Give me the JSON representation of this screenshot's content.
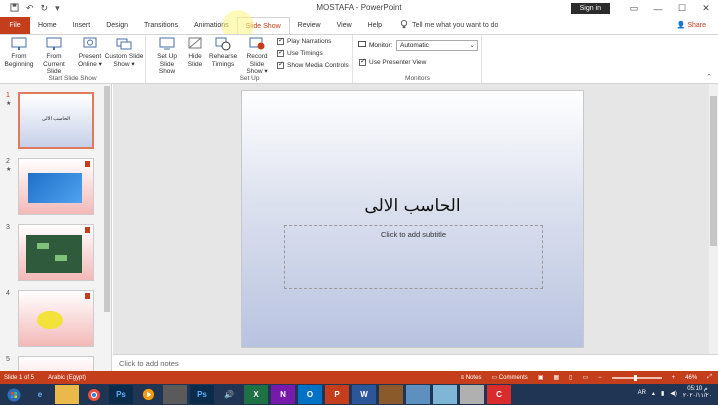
{
  "window": {
    "title": "MOSTAFA - PowerPoint",
    "sign_in": "Sign in",
    "controls": [
      "—",
      "☐",
      "✕"
    ]
  },
  "qat": {
    "save_icon": "save-icon",
    "undo_icon": "undo-icon",
    "redo_icon": "redo-icon"
  },
  "tabs": [
    {
      "label": "File"
    },
    {
      "label": "Home"
    },
    {
      "label": "Insert"
    },
    {
      "label": "Design"
    },
    {
      "label": "Transitions"
    },
    {
      "label": "Animations"
    },
    {
      "label": "Slide Show",
      "active": true
    },
    {
      "label": "Review"
    },
    {
      "label": "View"
    },
    {
      "label": "Help"
    }
  ],
  "tell_me": "Tell me what you want to do",
  "share": "Share",
  "ribbon": {
    "start_group": {
      "label": "Start Slide Show",
      "from_beginning": [
        "From",
        "Beginning"
      ],
      "from_current": [
        "From",
        "Current Slide"
      ],
      "present_online": [
        "Present",
        "Online ▾"
      ],
      "custom_show": [
        "Custom Slide",
        "Show ▾"
      ]
    },
    "setup_group": {
      "label": "Set Up",
      "setup": [
        "Set Up",
        "Slide Show"
      ],
      "hide": [
        "Hide",
        "Slide"
      ],
      "rehearse": [
        "Rehearse",
        "Timings"
      ],
      "record": [
        "Record Slide",
        "Show ▾"
      ],
      "play_narrations": "Play Narrations",
      "use_timings": "Use Timings",
      "show_media": "Show Media Controls"
    },
    "monitors_group": {
      "label": "Monitors",
      "monitor_label": "Monitor:",
      "monitor_value": "Automatic",
      "presenter_view": "Use Presenter View"
    }
  },
  "thumbnails": [
    {
      "num": "1",
      "caption": "الحاسب الالى",
      "star": "★"
    },
    {
      "num": "2",
      "star": "★"
    },
    {
      "num": "3"
    },
    {
      "num": "4"
    },
    {
      "num": "5"
    }
  ],
  "slide": {
    "title": "الحاسب الالى",
    "subtitle_placeholder": "Click to add subtitle"
  },
  "notes_placeholder": "Click to add notes",
  "status": {
    "slide_counter": "Slide 1 of 5",
    "language": "Arabic (Egypt)",
    "notes": "Notes",
    "comments": "Comments",
    "zoom": "46%"
  },
  "taskbar": {
    "lang": "AR",
    "time": "05:10 م",
    "date": "٢٠٢٠/١١/٢٠"
  },
  "colors": {
    "accent": "#c43e1c",
    "taskbar": "#1f3553"
  }
}
